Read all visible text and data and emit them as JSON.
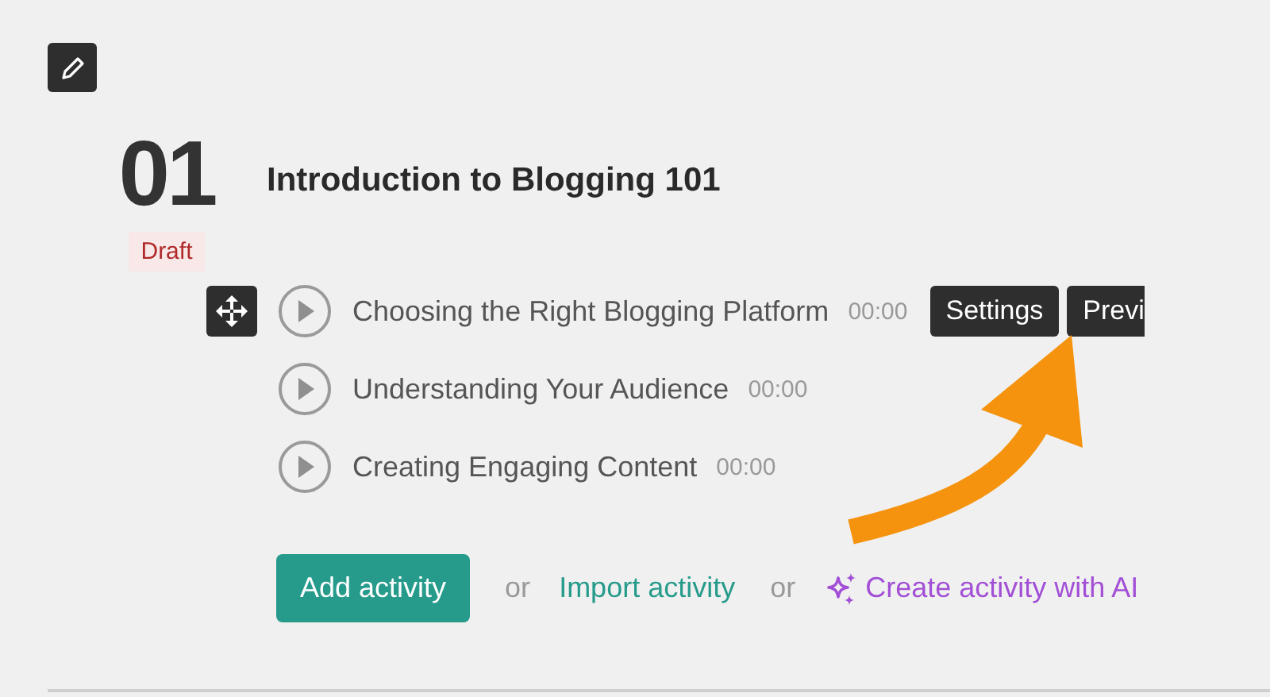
{
  "section": {
    "number": "01",
    "status": "Draft",
    "title": "Introduction to Blogging 101"
  },
  "activities": [
    {
      "title": "Choosing the Right Blogging Platform",
      "duration": "00:00",
      "hovered": true,
      "actions": [
        "Settings",
        "Previ"
      ]
    },
    {
      "title": "Understanding Your Audience",
      "duration": "00:00",
      "hovered": false
    },
    {
      "title": "Creating Engaging Content",
      "duration": "00:00",
      "hovered": false
    }
  ],
  "add_bar": [
    {
      "kind": "button",
      "label": "Add activity"
    },
    {
      "kind": "separator",
      "label": "or"
    },
    {
      "kind": "link",
      "label": "Import activity"
    },
    {
      "kind": "separator",
      "label": "or"
    },
    {
      "kind": "ai_link",
      "label": "Create activity with AI"
    }
  ],
  "annotation": {
    "kind": "arrow"
  }
}
